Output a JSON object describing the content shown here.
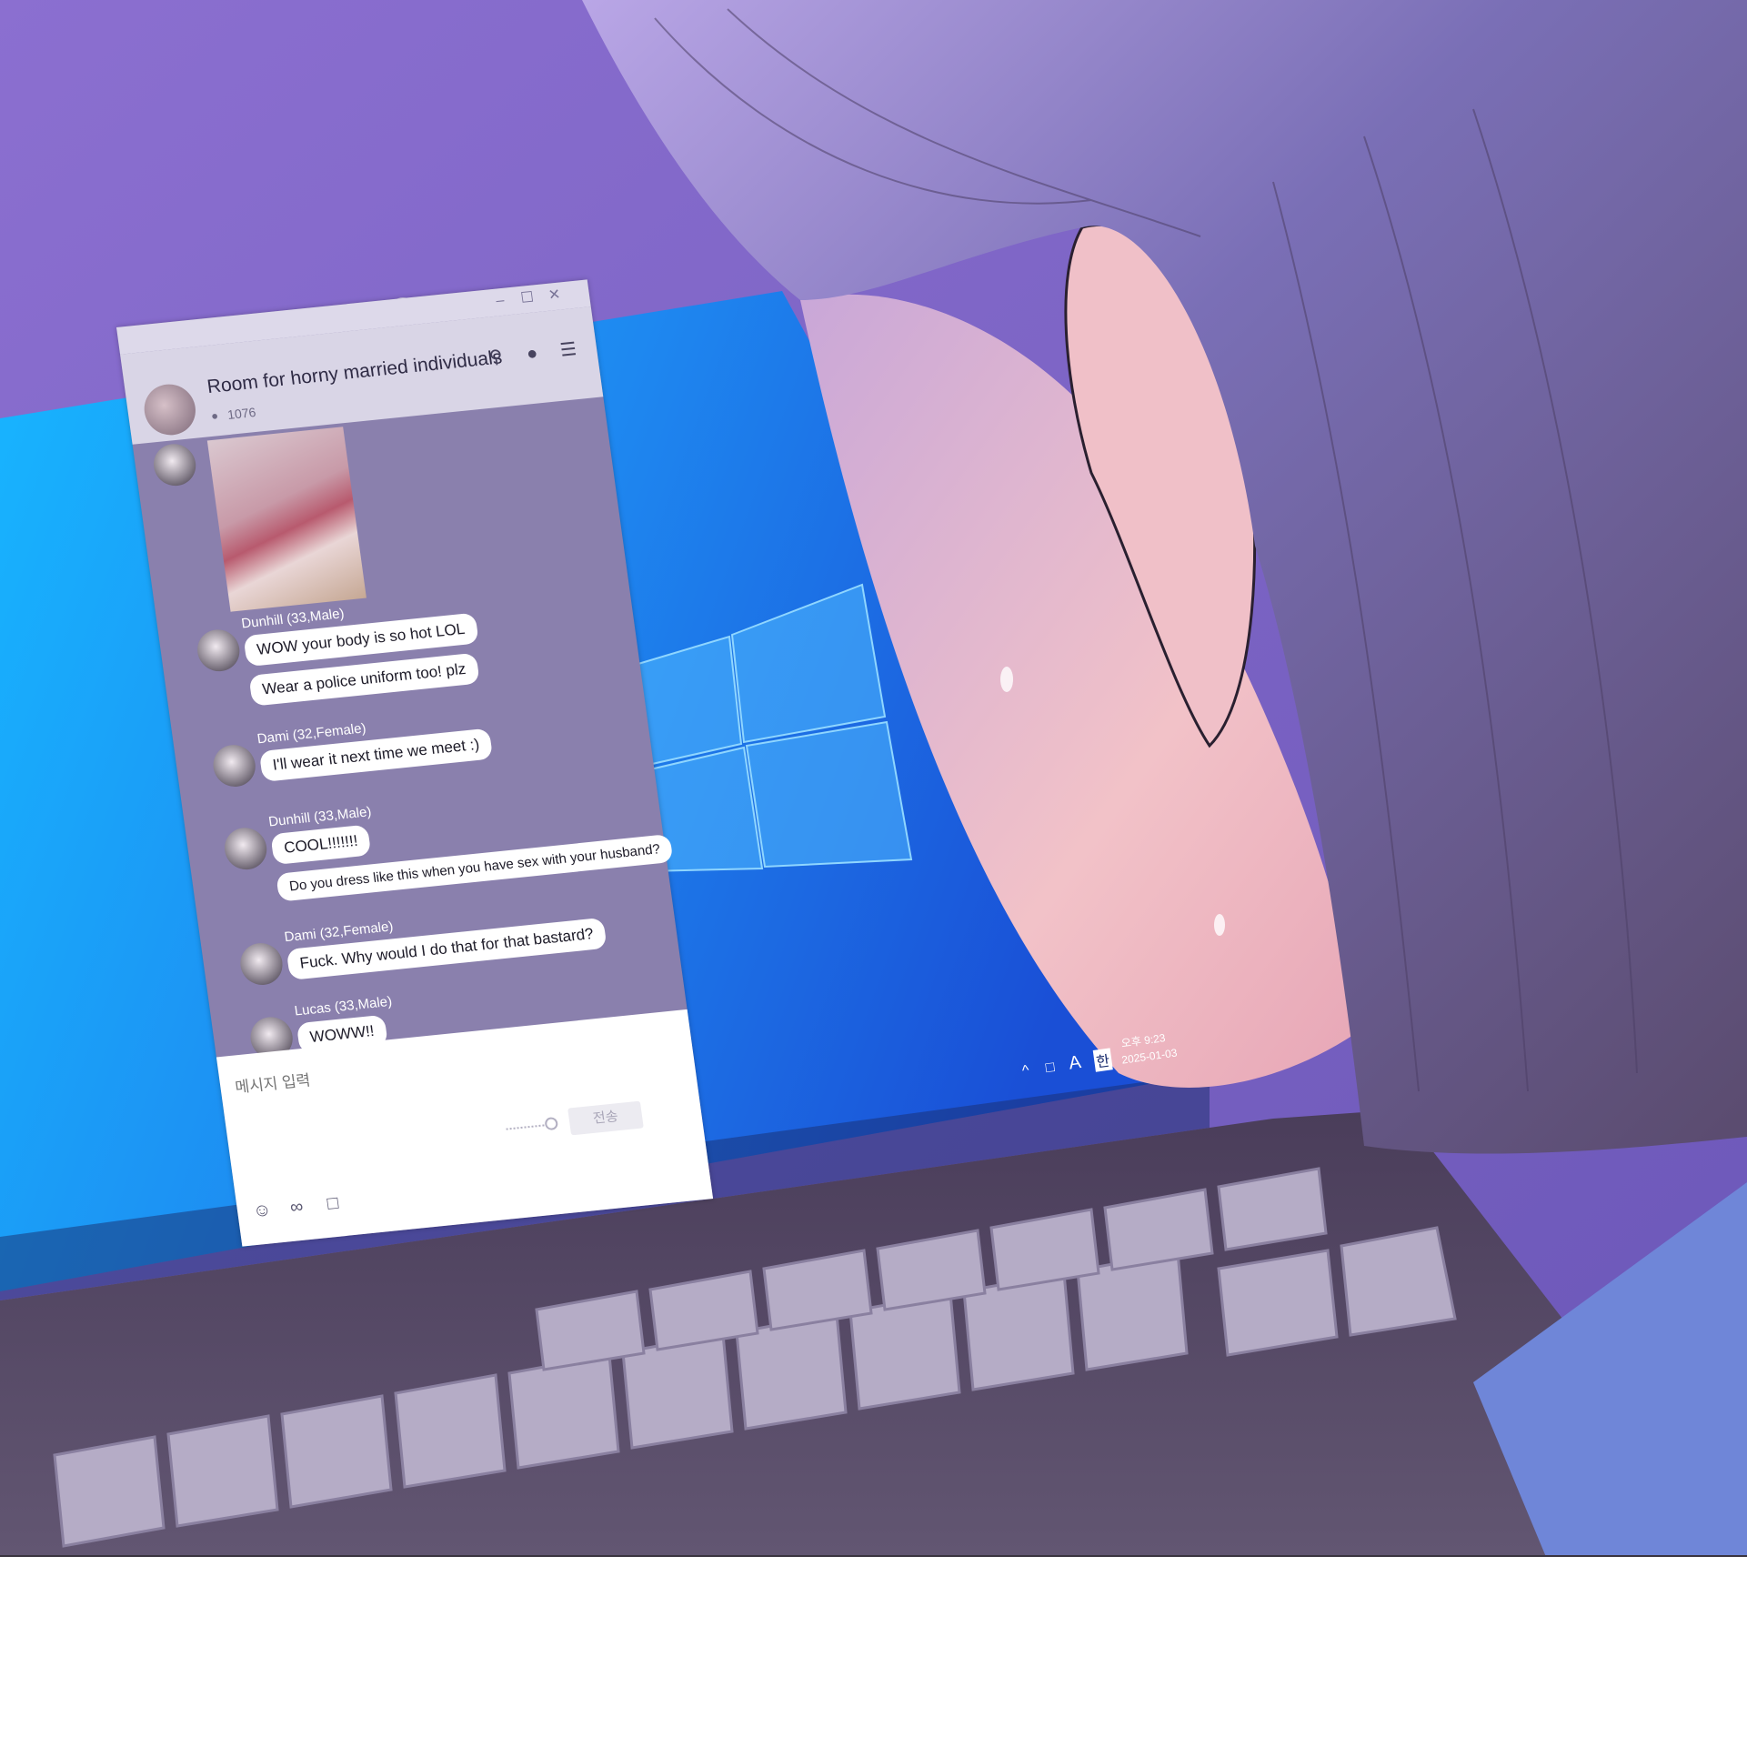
{
  "chat": {
    "room_title": "Room for horny married individuals",
    "member_count": "1076",
    "messages": [
      {
        "sender": "Dunhill (33,Male)",
        "bubbles": [
          "WOW your body is so hot LOL",
          "Wear a police uniform too! plz"
        ]
      },
      {
        "sender": "Dami (32,Female)",
        "bubbles": [
          "I'll wear it next time we meet :)"
        ]
      },
      {
        "sender": "Dunhill (33,Male)",
        "bubbles": [
          "COOL!!!!!!!",
          "Do you dress like this when you have sex with your husband?"
        ]
      },
      {
        "sender": "Dami (32,Female)",
        "bubbles": [
          "Fuck. Why would I do that for that bastard?"
        ]
      },
      {
        "sender": "Lucas (33,Male)",
        "bubbles": [
          "WOWW!!"
        ]
      }
    ],
    "input_placeholder": "메시지 입력",
    "send_label": "전송"
  },
  "taskbar": {
    "ime_label": "A",
    "lang_label": "한",
    "time": "오후 9:23",
    "date": "2025-01-03"
  },
  "icons": {
    "window": [
      "minimize-icon",
      "maximize-icon",
      "close-icon"
    ],
    "header": [
      "search-icon",
      "microphone-icon",
      "menu-icon"
    ],
    "input": [
      "emoji-icon",
      "attachment-icon",
      "crop-icon"
    ],
    "tray": [
      "chevron-up-icon",
      "network-icon"
    ]
  },
  "colors": {
    "desktop": "#1e88f0",
    "chat_bg": "#8a80ad",
    "header_bg": "#d9d5e6",
    "hair": "#7a6fb6"
  }
}
